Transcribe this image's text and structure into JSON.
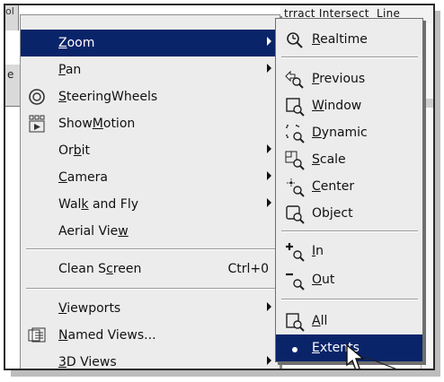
{
  "background": {
    "tab_text": "trract  Intersect",
    "tab_text_right": "Line",
    "side_letter": "e",
    "top_left_glyph": "ol"
  },
  "main_menu": {
    "items": [
      {
        "label_pre": "",
        "mnemonic": "Z",
        "label_post": "oom",
        "submenu": true,
        "highlighted": true
      },
      {
        "label_pre": "",
        "mnemonic": "P",
        "label_post": "an",
        "submenu": true
      },
      {
        "label_pre": "",
        "mnemonic": "S",
        "label_post": "teeringWheels",
        "icon": "steering-wheel-icon"
      },
      {
        "label_pre": "Show",
        "mnemonic": "M",
        "label_post": "otion",
        "icon": "showmotion-icon"
      },
      {
        "label_pre": "Or",
        "mnemonic": "b",
        "label_post": "it",
        "submenu": true
      },
      {
        "label_pre": "",
        "mnemonic": "C",
        "label_post": "amera",
        "submenu": true
      },
      {
        "label_pre": "Wal",
        "mnemonic": "k",
        "label_post": " and Fly",
        "submenu": true
      },
      {
        "label_pre": "Aerial Vie",
        "mnemonic": "w",
        "label_post": ""
      },
      {
        "label_pre": "Clean S",
        "mnemonic": "c",
        "label_post": "reen",
        "shortcut": "Ctrl+0"
      },
      {
        "label_pre": "",
        "mnemonic": "V",
        "label_post": "iewports",
        "submenu": true
      },
      {
        "label_pre": "",
        "mnemonic": "N",
        "label_post": "amed Views...",
        "icon": "named-views-icon"
      },
      {
        "label_pre": "",
        "mnemonic": "3",
        "label_post": "D Views",
        "submenu": true
      }
    ]
  },
  "zoom_submenu": {
    "items": [
      {
        "mnemonic": "R",
        "label_post": "ealtime",
        "icon": "zoom-realtime-icon"
      },
      {
        "mnemonic": "P",
        "label_post": "revious",
        "icon": "zoom-previous-icon"
      },
      {
        "mnemonic": "W",
        "label_post": "indow",
        "icon": "zoom-window-icon"
      },
      {
        "mnemonic": "D",
        "label_post": "ynamic",
        "icon": "zoom-dynamic-icon"
      },
      {
        "mnemonic": "S",
        "label_post": "cale",
        "icon": "zoom-scale-icon"
      },
      {
        "mnemonic": "C",
        "label_post": "enter",
        "icon": "zoom-center-icon"
      },
      {
        "mnemonic": "",
        "label_post": "Object",
        "icon": "zoom-object-icon"
      },
      {
        "mnemonic": "I",
        "label_post": "n",
        "icon": "zoom-in-icon"
      },
      {
        "mnemonic": "O",
        "label_post": "ut",
        "icon": "zoom-out-icon"
      },
      {
        "mnemonic": "A",
        "label_post": "ll",
        "icon": "zoom-all-icon"
      },
      {
        "mnemonic": "E",
        "label_post": "xtents",
        "icon": "zoom-extents-icon",
        "highlighted": true
      }
    ]
  },
  "colors": {
    "highlight": "#0a246a",
    "menu_bg": "#ececec"
  }
}
